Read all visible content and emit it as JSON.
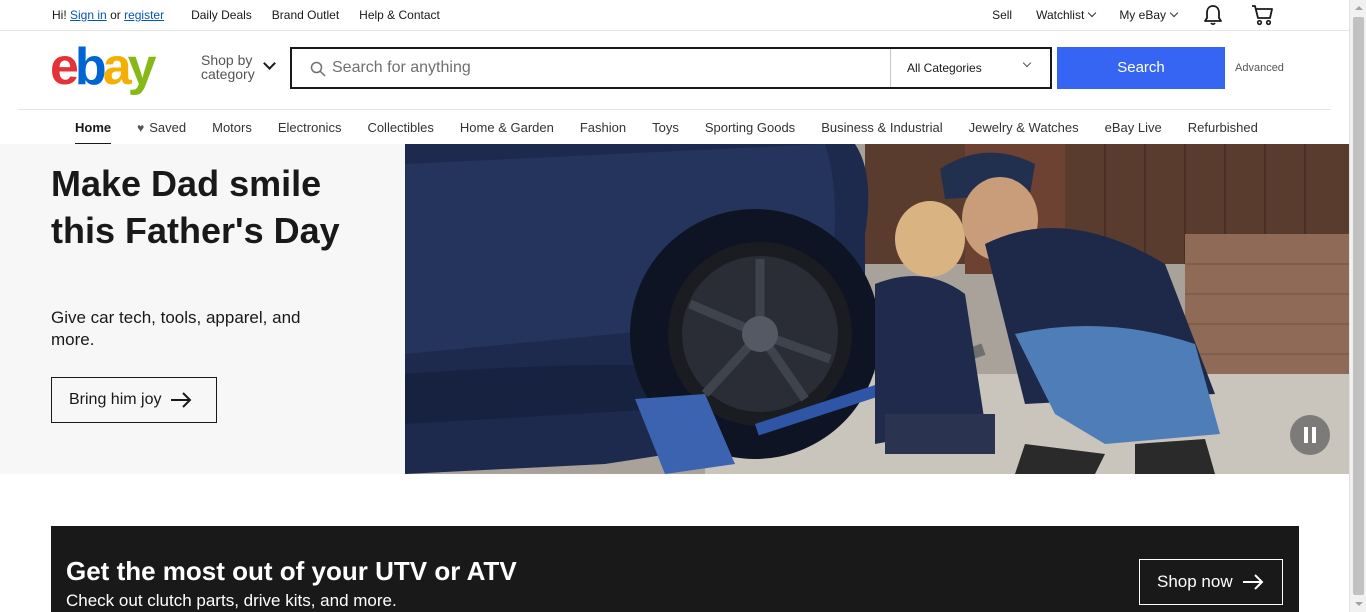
{
  "topbar": {
    "greeting": "Hi!",
    "sign_in": "Sign in",
    "or": "or",
    "register": "register",
    "daily_deals": "Daily Deals",
    "brand_outlet": "Brand Outlet",
    "help_contact": "Help & Contact",
    "sell": "Sell",
    "watchlist": "Watchlist",
    "my_ebay": "My eBay"
  },
  "header": {
    "logo": {
      "e": "e",
      "b": "b",
      "a": "a",
      "y": "y"
    },
    "shop_by_line1": "Shop by",
    "shop_by_line2": "category",
    "search_placeholder": "Search for anything",
    "category_selected": "All Categories",
    "search_button": "Search",
    "advanced": "Advanced"
  },
  "nav": {
    "items": [
      "Home",
      "Saved",
      "Motors",
      "Electronics",
      "Collectibles",
      "Home & Garden",
      "Fashion",
      "Toys",
      "Sporting Goods",
      "Business & Industrial",
      "Jewelry & Watches",
      "eBay Live",
      "Refurbished"
    ]
  },
  "hero": {
    "title": "Make Dad smile this Father's Day",
    "subtitle": "Give car tech, tools, apparel, and more.",
    "cta": "Bring him joy"
  },
  "promo": {
    "title": "Get the most out of your UTV or ATV",
    "subtitle": "Check out clutch parts, drive kits, and more.",
    "cta": "Shop now"
  },
  "colors": {
    "search_blue": "#3665f3",
    "link_blue": "#0654ba",
    "logo_red": "#e53238",
    "logo_blue": "#0064d2",
    "logo_yellow": "#f5af02",
    "logo_green": "#86b817",
    "promo_bg": "#191919"
  }
}
